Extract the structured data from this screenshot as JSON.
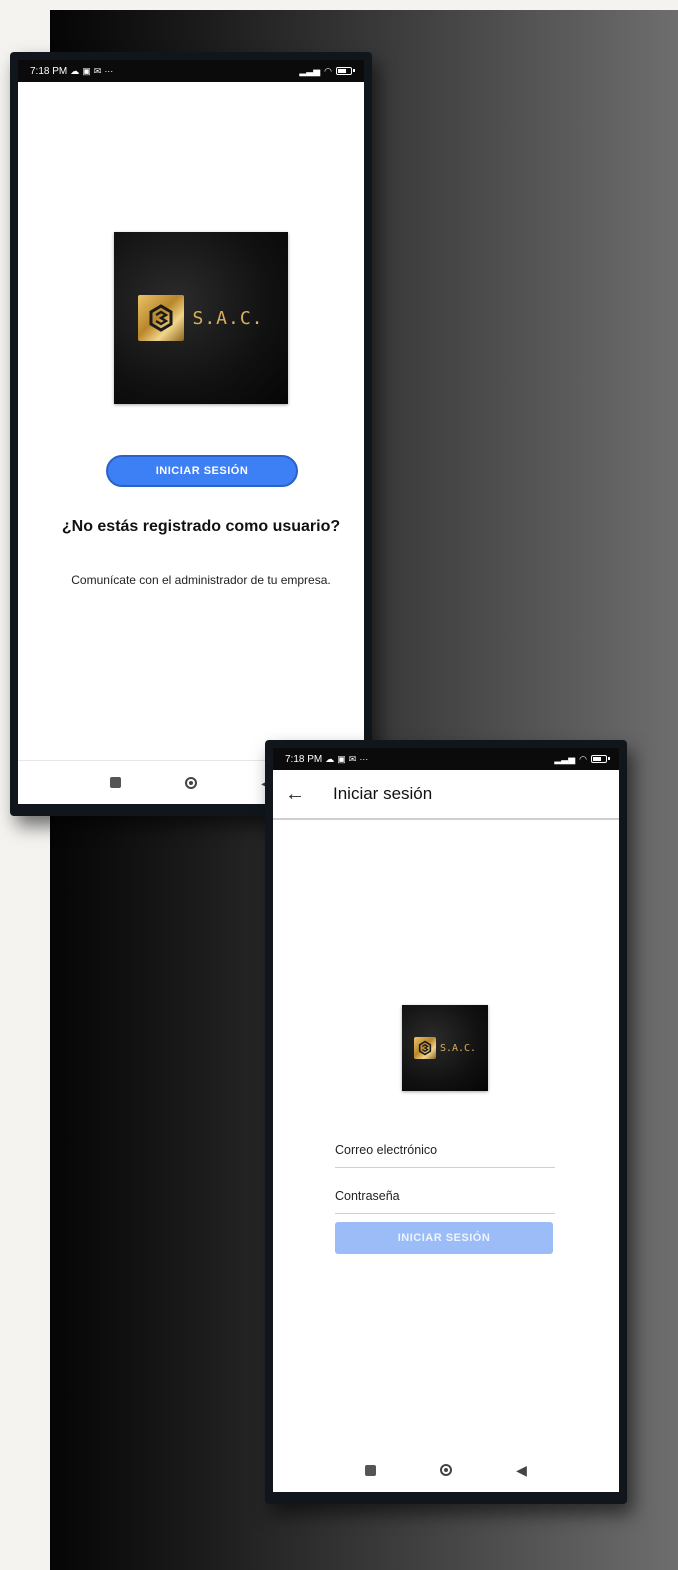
{
  "screen_home": {
    "status": {
      "time": "7:18 PM",
      "ellipsis": "···"
    },
    "logo": {
      "wordmark": "S.A.C."
    },
    "login_button": "INICIAR SESIÓN",
    "not_registered_title": "¿No estás registrado como usuario?",
    "not_registered_text": "Comunícate con el administrador de tu empresa."
  },
  "screen_login": {
    "status": {
      "time": "7:18 PM",
      "ellipsis": "···"
    },
    "appbar": {
      "back_icon": "←",
      "title": "Iniciar sesión"
    },
    "logo": {
      "wordmark": "S.A.C."
    },
    "email_field": {
      "placeholder": "Correo electrónico"
    },
    "password_field": {
      "placeholder": "Contraseña"
    },
    "login_button": "INICIAR SESIÓN"
  },
  "icons": {
    "status_left": [
      "cloud-icon",
      "notification-icon",
      "mail-icon"
    ],
    "status_right": [
      "signal-icon",
      "wifi-icon",
      "battery-icon"
    ],
    "nav": [
      "recents-square-icon",
      "home-circle-icon",
      "back-triangle-icon"
    ]
  },
  "colors": {
    "primary": "#3d7ff5",
    "primary_disabled": "#9bbcf7",
    "logo_gold": "#d8b15a",
    "status_bar": "#0b0b0b"
  }
}
